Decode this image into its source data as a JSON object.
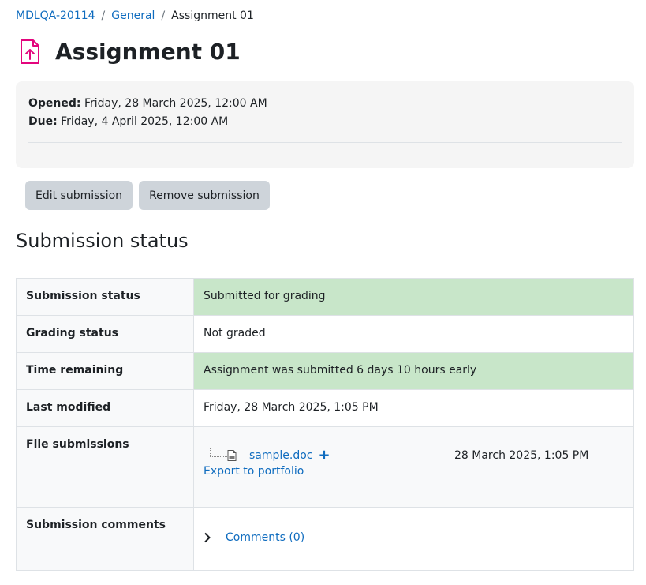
{
  "breadcrumb": {
    "items": [
      "MDLQA-20114",
      "General",
      "Assignment 01"
    ],
    "separator": "/"
  },
  "page": {
    "title": "Assignment 01",
    "icon": "assignment-upload-icon",
    "icon_color": "#e3057d"
  },
  "dates": {
    "opened_label": "Opened:",
    "opened_value": "Friday, 28 March 2025, 12:00 AM",
    "due_label": "Due:",
    "due_value": "Friday, 4 April 2025, 12:00 AM"
  },
  "actions": {
    "edit_label": "Edit submission",
    "remove_label": "Remove submission"
  },
  "section": {
    "title": "Submission status"
  },
  "status_table": {
    "submission_status": {
      "label": "Submission status",
      "value": "Submitted for grading"
    },
    "grading_status": {
      "label": "Grading status",
      "value": "Not graded"
    },
    "time_remaining": {
      "label": "Time remaining",
      "value": "Assignment was submitted 6 days 10 hours early"
    },
    "last_modified": {
      "label": "Last modified",
      "value": "Friday, 28 March 2025, 1:05 PM"
    },
    "file_submissions": {
      "label": "File submissions",
      "file_name": "sample.doc",
      "file_date": "28 March 2025, 1:05 PM",
      "export_label": "Export to portfolio"
    },
    "submission_comments": {
      "label": "Submission comments",
      "link": "Comments (0)"
    }
  },
  "colors": {
    "link": "#0f6cbf",
    "success_bg": "#c8e6c9",
    "button_bg": "#ced4da"
  }
}
